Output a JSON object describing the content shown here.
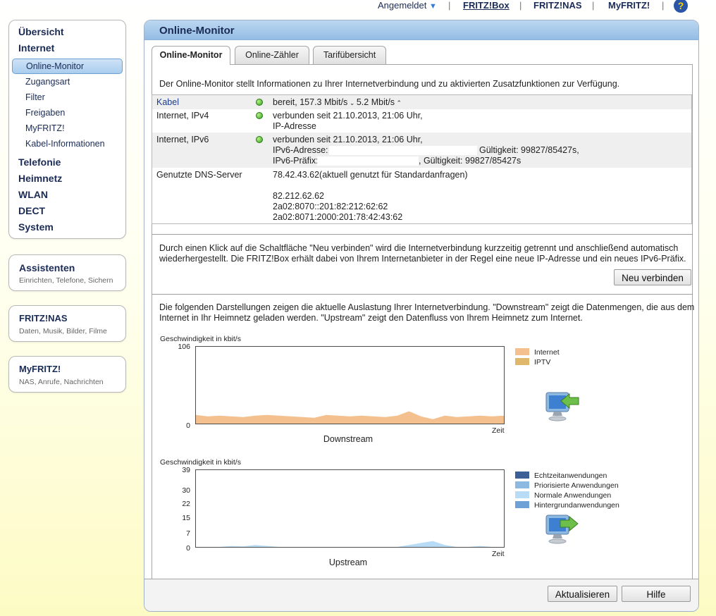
{
  "topbar": {
    "login": "Angemeldet",
    "links": [
      "FRITZ!Box",
      "FRITZ!NAS",
      "MyFRITZ!"
    ],
    "help": "?"
  },
  "nav": {
    "overview": "Übersicht",
    "internet": "Internet",
    "internet_items": [
      "Online-Monitor",
      "Zugangsart",
      "Filter",
      "Freigaben",
      "MyFRITZ!",
      "Kabel-Informationen"
    ],
    "more": [
      "Telefonie",
      "Heimnetz",
      "WLAN",
      "DECT",
      "System"
    ]
  },
  "boxes": [
    {
      "title": "Assistenten",
      "sub": "Einrichten, Telefone, Sichern"
    },
    {
      "title": "FRITZ!NAS",
      "sub": "Daten, Musik, Bilder, Filme"
    },
    {
      "title": "MyFRITZ!",
      "sub": "NAS, Anrufe, Nachrichten"
    }
  ],
  "panel": {
    "title": "Online-Monitor",
    "tabs": [
      "Online-Monitor",
      "Online-Zähler",
      "Tarifübersicht"
    ],
    "intro": "Der Online-Monitor stellt Informationen zu Ihrer Internetverbindung und zu aktivierten Zusatzfunktionen zur Verfügung.",
    "status": {
      "kabel_label": "Kabel",
      "kabel_value": "bereit, 157.3 Mbit/s",
      "kabel_up": "5.2 Mbit/s",
      "ipv4_label": "Internet, IPv4",
      "ipv4_line1": "verbunden seit 21.10.2013, 21:06 Uhr,",
      "ipv4_line2": "IP-Adresse",
      "ipv6_label": "Internet, IPv6",
      "ipv6_line1": "verbunden seit 21.10.2013, 21:06 Uhr,",
      "ipv6_addr_label": "IPv6-Adresse:",
      "ipv6_addr_valid": "Gültigkeit: 99827/85427s,",
      "ipv6_prefix_label": "IPv6-Präfix:",
      "ipv6_prefix_valid": ", Gültigkeit: 99827/85427s",
      "dns_label": "Genutzte DNS-Server",
      "dns_primary": "78.42.43.62(aktuell genutzt für Standardanfragen)",
      "dns_others": [
        "82.212.62.62",
        "2a02:8070::201:82:212:62:62",
        "2a02:8071:2000:201:78:42:43:62"
      ]
    },
    "reconnect_text": "Durch einen Klick auf die Schaltfläche \"Neu verbinden\" wird die Internetverbindung kurzzeitig getrennt und anschließend automatisch wiederhergestellt. Die FRITZ!Box erhält dabei von Ihrem Internetanbieter in der Regel eine neue IP-Adresse und ein neues IPv6-Präfix.",
    "reconnect_button": "Neu verbinden",
    "charts_text": "Die folgenden Darstellungen zeigen die aktuelle Auslastung Ihrer Internetverbindung. \"Downstream\" zeigt die Datenmengen, die aus dem Internet in Ihr Heimnetz geladen werden. \"Upstream\" zeigt den Datenfluss von Ihrem Heimnetz zum Internet.",
    "refresh_button": "Aktualisieren",
    "help_button": "Hilfe"
  },
  "colors": {
    "internet": "#f4c08e",
    "iptv": "#e0b86c",
    "echtzeit": "#3c5f96",
    "priorisiert": "#8db8e0",
    "normal": "#b8dcf5",
    "hintergrund": "#6ea2d6"
  },
  "chart_data": [
    {
      "type": "area",
      "title": "Downstream",
      "ylabel": "Geschwindigkeit in kbit/s",
      "xlabel": "Zeit",
      "ylim": [
        0,
        106
      ],
      "yticks": [
        106,
        0
      ],
      "legend": [
        "Internet",
        "IPTV"
      ],
      "series": [
        {
          "name": "Internet",
          "values": [
            12,
            10,
            11,
            10,
            9,
            11,
            12,
            11,
            10,
            9,
            8,
            12,
            11,
            10,
            11,
            10,
            9,
            11,
            17,
            10,
            6,
            11,
            9,
            10,
            11,
            10,
            11
          ]
        },
        {
          "name": "IPTV",
          "values": [
            0,
            0,
            0,
            0,
            0,
            0,
            0,
            0,
            0,
            0,
            0,
            0,
            0,
            0,
            0,
            0,
            0,
            0,
            0,
            0,
            0,
            0,
            0,
            0,
            0,
            0,
            0
          ]
        }
      ]
    },
    {
      "type": "area",
      "title": "Upstream",
      "ylabel": "Geschwindigkeit in kbit/s",
      "xlabel": "Zeit",
      "ylim": [
        0,
        39
      ],
      "yticks": [
        39,
        30,
        22,
        15,
        7,
        0
      ],
      "legend": [
        "Echtzeitanwendungen",
        "Priorisierte Anwendungen",
        "Normale Anwendungen",
        "Hintergrundanwendungen"
      ],
      "series": [
        {
          "name": "Normale Anwendungen",
          "values": [
            0,
            0,
            0,
            0.5,
            0.3,
            1,
            0.5,
            0,
            0,
            0,
            0,
            0,
            0,
            0,
            0,
            0,
            0,
            0,
            1,
            2,
            3,
            1,
            0,
            0,
            0.5,
            0,
            0
          ]
        }
      ]
    }
  ]
}
